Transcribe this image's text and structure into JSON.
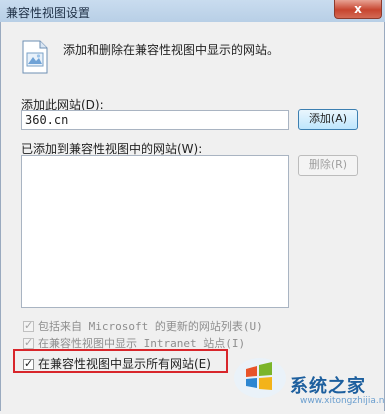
{
  "window": {
    "title": "兼容性视图设置",
    "close_label": "x"
  },
  "intro": {
    "icon": "website-icon",
    "text": "添加和删除在兼容性视图中显示的网站。"
  },
  "add_site": {
    "label": "添加此网站(D):",
    "value": "360.cn",
    "add_button": "添加(A)"
  },
  "site_list": {
    "label": "已添加到兼容性视图中的网站(W):",
    "items": [],
    "remove_button": "删除(R)"
  },
  "options": [
    {
      "text": "包括来自 Microsoft 的更新的网站列表(U)",
      "checked": true,
      "enabled": false
    },
    {
      "text": "在兼容性视图中显示 Intranet 站点(I)",
      "checked": true,
      "enabled": false
    },
    {
      "text": "在兼容性视图中显示所有网站(E)",
      "checked": true,
      "enabled": true
    }
  ],
  "watermark": {
    "logo": "win7-logo-icon",
    "text": "系统之家",
    "url": "www.xitongzhijia.net"
  },
  "colors": {
    "highlight": "#d8262b",
    "primary_button_border": "#3c7fb1"
  }
}
